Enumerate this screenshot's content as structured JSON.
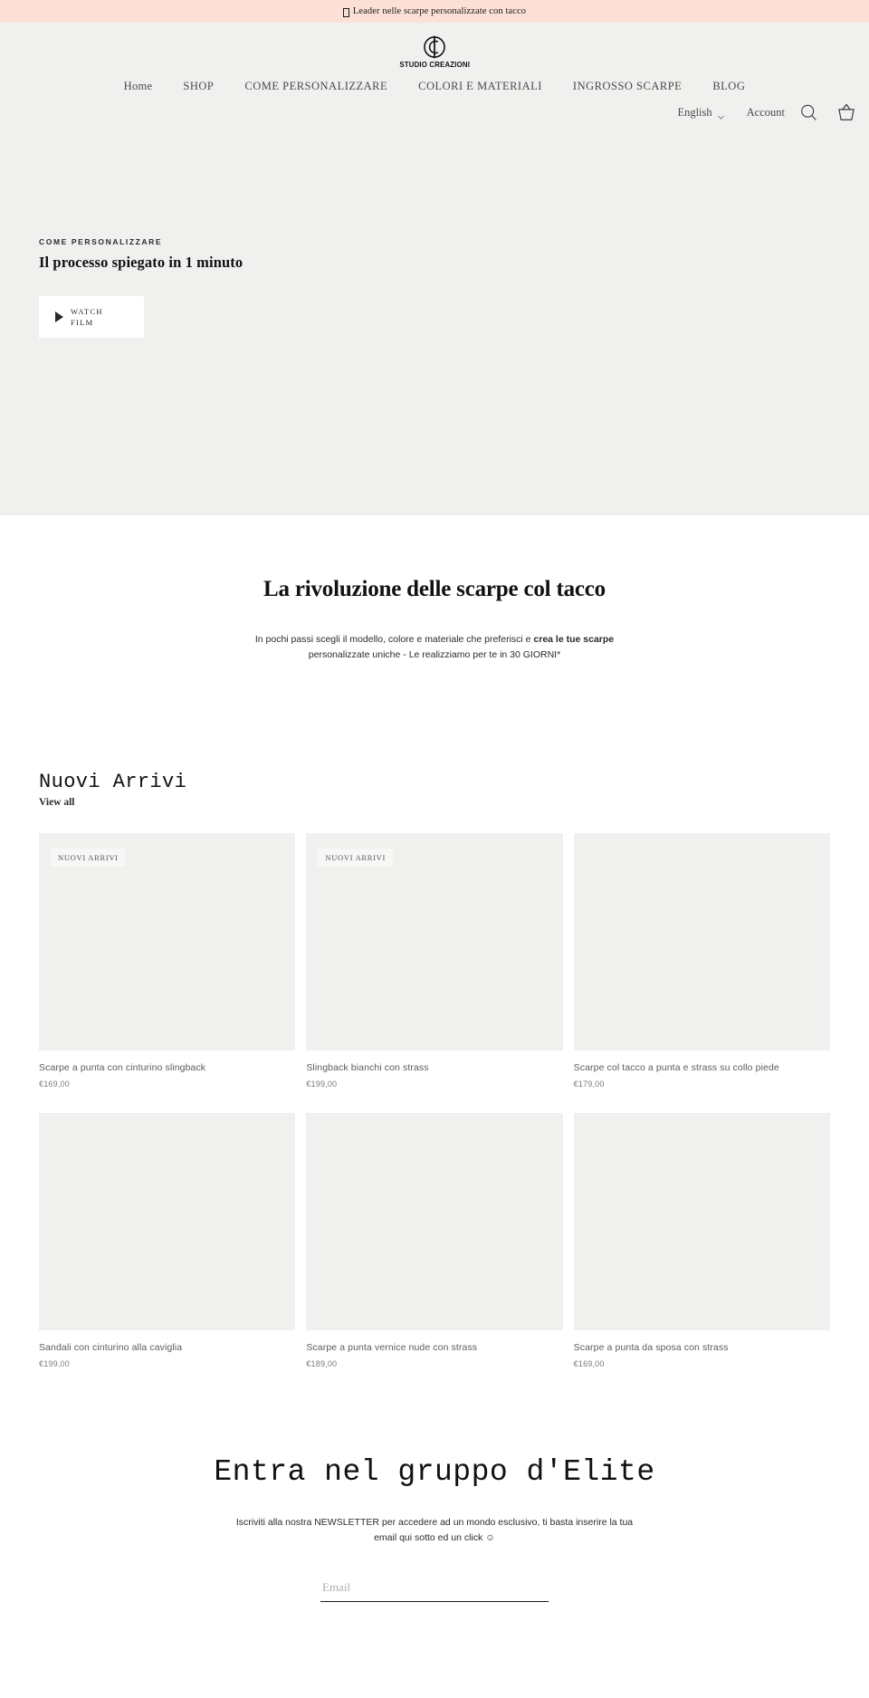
{
  "announcement": {
    "icon": "missing-glyph-tofu",
    "text": "Leader nelle scarpe personalizzate con tacco",
    "background": "#fce0d6"
  },
  "header": {
    "logo": {
      "mark": "sc-monogram-logo",
      "wordmark": "STUDIO CREAZIONI"
    },
    "nav": [
      {
        "label": "Home",
        "name": "nav-home"
      },
      {
        "label": "SHOP",
        "name": "nav-shop"
      },
      {
        "label": "COME PERSONALIZZARE",
        "name": "nav-come-personalizzare"
      },
      {
        "label": "COLORI E MATERIALI",
        "name": "nav-colori-e-materiali"
      },
      {
        "label": "INGROSSO SCARPE",
        "name": "nav-ingrosso-scarpe"
      },
      {
        "label": "BLOG",
        "name": "nav-blog"
      }
    ],
    "utility": {
      "language": "English",
      "language_chevron": "chevron-down-icon",
      "account": "Account",
      "search_icon": "search-icon",
      "cart_icon": "shopping-basket-icon"
    },
    "background": "#f0f0ef"
  },
  "hero": {
    "eyebrow": "COME PERSONALIZZARE",
    "title": "Il processo spiegato in 1 minuto",
    "cta": {
      "icon": "play-icon",
      "label": "WATCH FILM"
    },
    "background": "#f0f0ef"
  },
  "intro": {
    "title": "La rivoluzione delle scarpe col tacco",
    "body_part1": "In pochi passi scegli il modello, colore e materiale che preferisci e ",
    "body_bold": "crea le tue scarpe",
    "body_part2": " personalizzate uniche - Le realizziamo per te in 30 GIORNI*"
  },
  "products": {
    "section_title": "Nuovi Arrivi",
    "view_all": "View all",
    "badge_label": "NUOVI ARRIVI",
    "items": [
      {
        "title": "Scarpe a punta con cinturino slingback",
        "price": "€169,00",
        "badge": "NUOVI ARRIVI",
        "has_badge": true
      },
      {
        "title": "Slingback bianchi con strass",
        "price": "€199,00",
        "badge": "NUOVI ARRIVI",
        "has_badge": true
      },
      {
        "title": "Scarpe col tacco a punta e strass su collo piede",
        "price": "€179,00",
        "badge": "",
        "has_badge": false
      },
      {
        "title": "Sandali con cinturino alla caviglia",
        "price": "€199,00",
        "badge": "",
        "has_badge": false
      },
      {
        "title": "Scarpe a punta vernice nude con strass",
        "price": "€189,00",
        "badge": "",
        "has_badge": false
      },
      {
        "title": "Scarpe a punta da sposa con strass",
        "price": "€169,00",
        "badge": "",
        "has_badge": false
      }
    ]
  },
  "newsletter": {
    "title": "Entra nel gruppo d'Elite",
    "body_line1": "Iscriviti alla nostra NEWSLETTER per accedere ad un mondo esclusivo, ti basta inserire",
    "body_line2": "la tua email qui sotto ed un click ☺",
    "email_placeholder": "Email",
    "email_value": ""
  }
}
